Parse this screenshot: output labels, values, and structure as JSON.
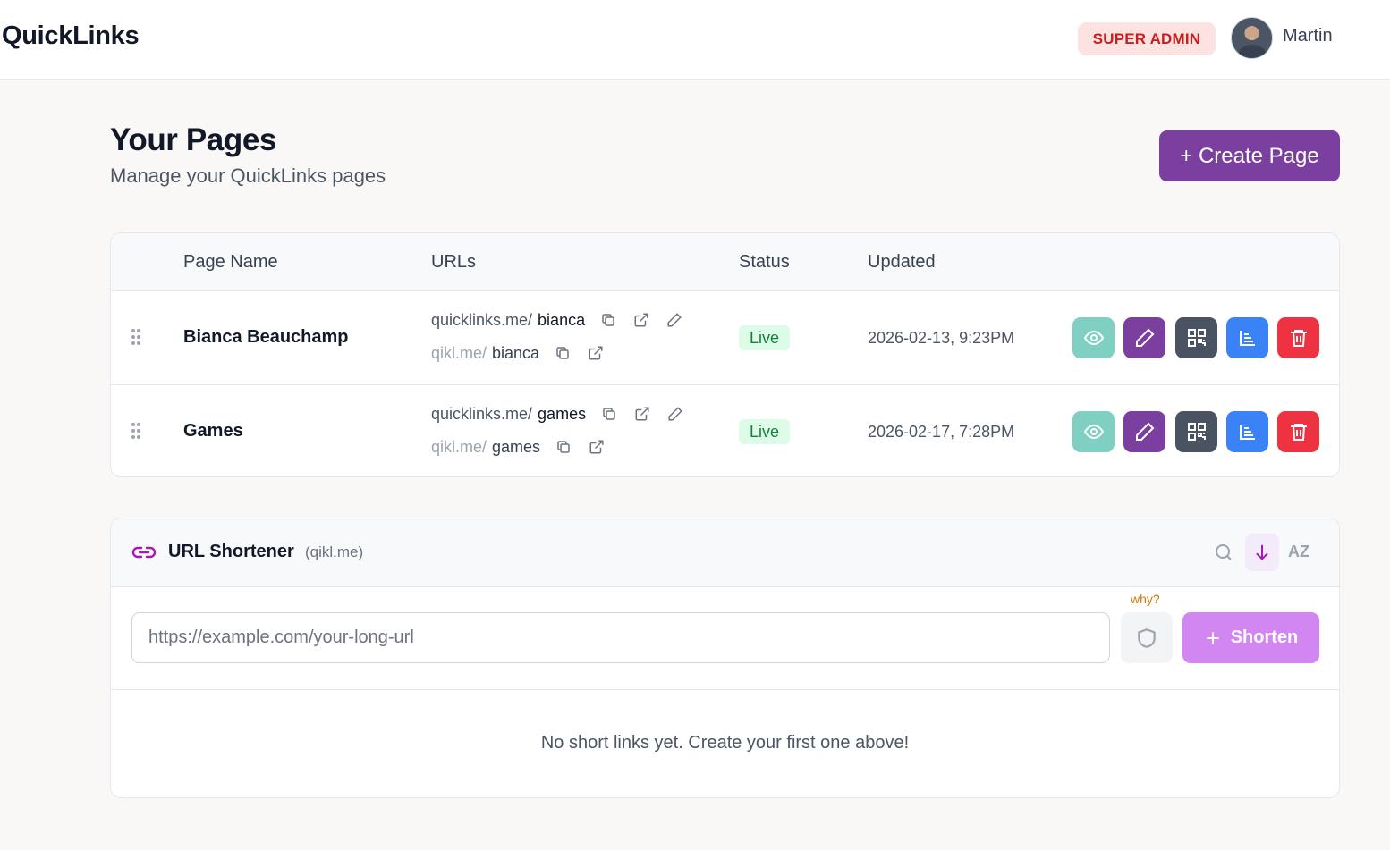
{
  "app": {
    "brand": "QuickLinks"
  },
  "header": {
    "role_badge": "SUPER ADMIN",
    "user_name": "Martin"
  },
  "page": {
    "title": "Your Pages",
    "subtitle": "Manage your QuickLinks pages",
    "create_button": "+ Create Page"
  },
  "table": {
    "columns": [
      "Page Name",
      "URLs",
      "Status",
      "Updated"
    ],
    "rows": [
      {
        "name": "Bianca Beauchamp",
        "primary_prefix": "quicklinks.me/",
        "primary_slug": "bianca",
        "short_prefix": "qikl.me/",
        "short_slug": "bianca",
        "status": "Live",
        "updated": "2026-02-13, 9:23PM"
      },
      {
        "name": "Games",
        "primary_prefix": "quicklinks.me/",
        "primary_slug": "games",
        "short_prefix": "qikl.me/",
        "short_slug": "games",
        "status": "Live",
        "updated": "2026-02-17, 7:28PM"
      }
    ],
    "action_icons": [
      "eye-icon",
      "pencil-icon",
      "qr-code-icon",
      "bar-chart-icon",
      "trash-icon"
    ]
  },
  "shortener": {
    "title": "URL Shortener",
    "domain": "(qikl.me)",
    "sort_label": "AZ",
    "why_label": "why?",
    "input_placeholder": "https://example.com/your-long-url",
    "shorten_button": "Shorten",
    "empty_message": "No short links yet. Create your first one above!"
  },
  "colors": {
    "brand_purple": "#7b3fa0",
    "shorten_button": "#d186f1",
    "badge_admin_bg": "#fde2e2",
    "badge_admin_text": "#c81e1e",
    "status_live_bg": "#dcfce7",
    "status_live_text": "#15803d",
    "view_button": "#7fd0c2",
    "qr_button": "#4a5361",
    "stats_button": "#3b82f6",
    "delete_button": "#ef3241"
  }
}
